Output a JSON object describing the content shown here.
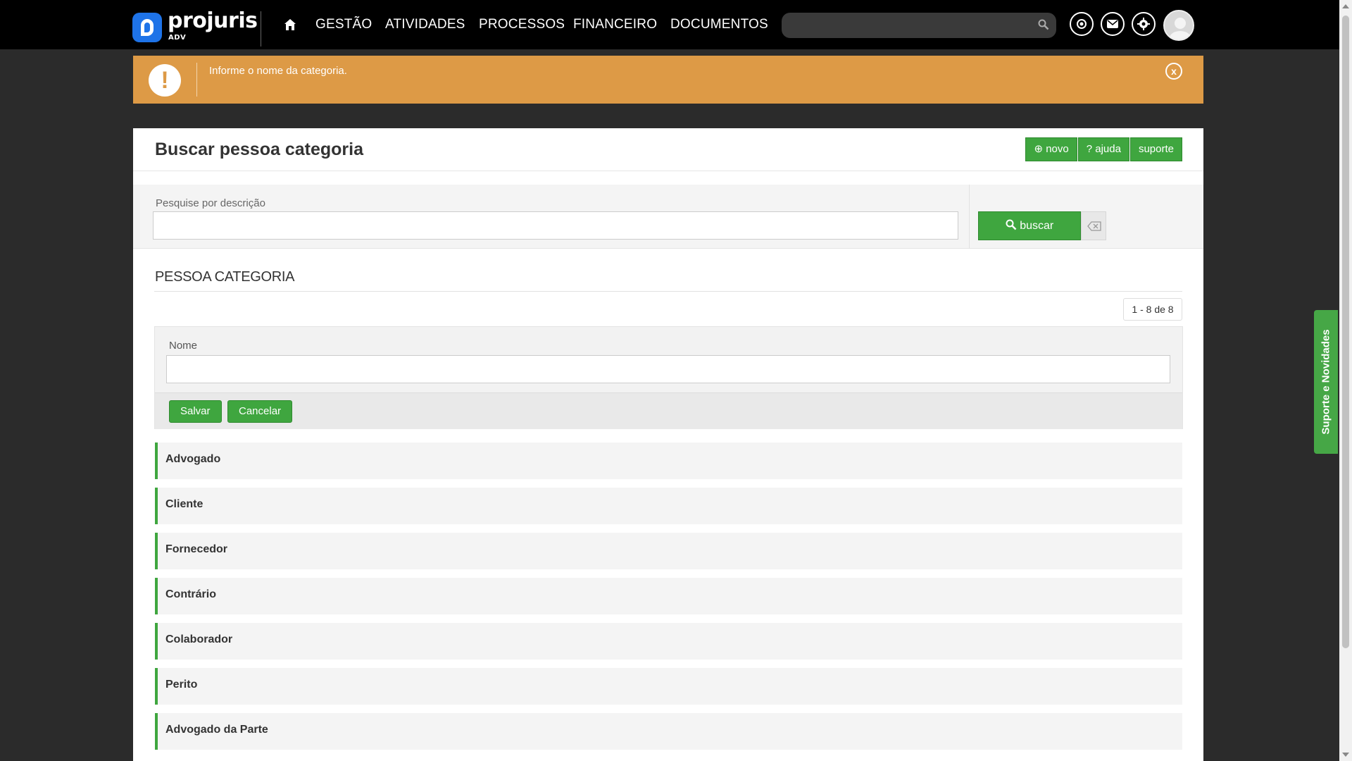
{
  "brand": {
    "name": "projuris",
    "sub": "ADV"
  },
  "nav": {
    "items": [
      {
        "label": "GESTÃO"
      },
      {
        "label": "ATIVIDADES"
      },
      {
        "label": "PROCESSOS"
      },
      {
        "label": "FINANCEIRO"
      },
      {
        "label": "DOCUMENTOS"
      }
    ],
    "search_placeholder": ""
  },
  "alert": {
    "message": "Informe o nome da categoria.",
    "icon": "!",
    "close": "x"
  },
  "page": {
    "title": "Buscar pessoa categoria",
    "buttons": {
      "novo": "novo",
      "ajuda": "ajuda",
      "suporte": "suporte"
    }
  },
  "filter": {
    "label": "Pesquise por descrição",
    "value": "",
    "search_button": "buscar"
  },
  "section": {
    "title": "PESSOA CATEGORIA",
    "pager": "1 - 8 de 8"
  },
  "edit": {
    "label": "Nome",
    "value": "",
    "save": "Salvar",
    "cancel": "Cancelar"
  },
  "categories": [
    "Advogado",
    "Cliente",
    "Fornecedor",
    "Contrário",
    "Colaborador",
    "Perito",
    "Advogado da Parte"
  ],
  "side_tab": {
    "label": "Suporte e Novidades"
  },
  "colors": {
    "accent": "#3fa63f",
    "alert": "#dd9a46",
    "topbar": "#000000"
  }
}
